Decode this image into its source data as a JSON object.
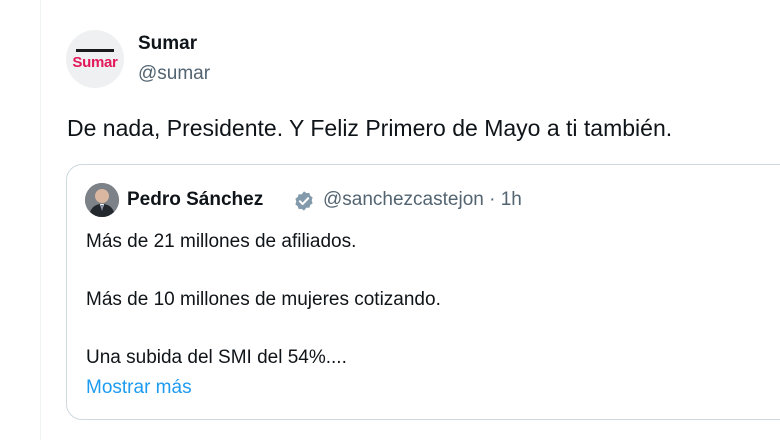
{
  "tweet": {
    "author": {
      "display_name": "Sumar",
      "handle": "@sumar",
      "avatar_logo_text": "Sumar",
      "avatar_logo_color": "#e3195a"
    },
    "text": "De nada, Presidente. Y Feliz Primero de Mayo a ti también."
  },
  "quoted_tweet": {
    "author": {
      "display_name": "Pedro Sánchez",
      "verified_icon": "verified-badge-icon",
      "verified_color": "#829aab",
      "handle": "@sanchezcastejon · 1h"
    },
    "lines": [
      "Más de 21 millones de afiliados.",
      "Más de 10 millones de mujeres cotizando.",
      "Una subida del SMI del 54%...."
    ],
    "show_more": "Mostrar más",
    "link_color": "#1d9bf0"
  }
}
